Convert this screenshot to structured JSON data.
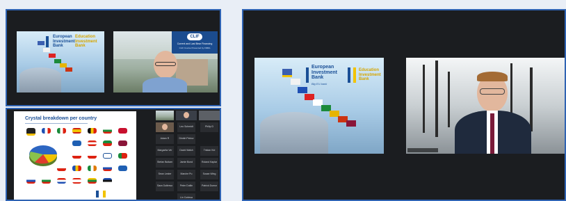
{
  "window_top_left": {
    "slide": {
      "bank_name": "European Investment Bank",
      "partner_name": "Education Investment Bank"
    },
    "speaker_slide": {
      "logo": "CLIF",
      "title": "Current and Last Bear Financing",
      "subtitle": "CLIF Course Presented by FMBA"
    }
  },
  "window_bottom_left": {
    "slide": {
      "title": "Crystal breakdown per country"
    },
    "participants": [
      "Leo Schmidt",
      "Philip D",
      "Adam R",
      "Dimitri Petrov",
      "Margarita Ver",
      "David Walsh",
      "Tristan Kid",
      "Stefan Butlam",
      "Jamie Bond",
      "Roland Kaplan",
      "Sean Lester",
      "Marche Pu",
      "Susan Wing",
      "Sara Gutlerson",
      "Peter Dutlin",
      "Patrick Dumon",
      "Lin Cortesa"
    ]
  },
  "window_right": {
    "slide": {
      "bank_name": "European Investment Bank",
      "tagline": "Big EU bank",
      "partner_name": "Education Investment Bank"
    },
    "participant_name": "Speaker"
  },
  "colors": {
    "window_border": "#2f63b3",
    "eib_blue": "#1a4f96",
    "eib_yellow": "#d5a500",
    "app_background": "#1b1d20"
  }
}
